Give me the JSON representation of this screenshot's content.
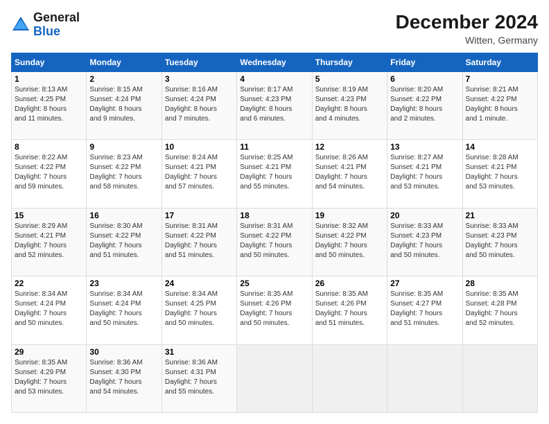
{
  "header": {
    "logo_general": "General",
    "logo_blue": "Blue",
    "month_year": "December 2024",
    "location": "Witten, Germany"
  },
  "calendar": {
    "days_of_week": [
      "Sunday",
      "Monday",
      "Tuesday",
      "Wednesday",
      "Thursday",
      "Friday",
      "Saturday"
    ],
    "weeks": [
      [
        {
          "day": "1",
          "info": "Sunrise: 8:13 AM\nSunset: 4:25 PM\nDaylight: 8 hours\nand 11 minutes."
        },
        {
          "day": "2",
          "info": "Sunrise: 8:15 AM\nSunset: 4:24 PM\nDaylight: 8 hours\nand 9 minutes."
        },
        {
          "day": "3",
          "info": "Sunrise: 8:16 AM\nSunset: 4:24 PM\nDaylight: 8 hours\nand 7 minutes."
        },
        {
          "day": "4",
          "info": "Sunrise: 8:17 AM\nSunset: 4:23 PM\nDaylight: 8 hours\nand 6 minutes."
        },
        {
          "day": "5",
          "info": "Sunrise: 8:19 AM\nSunset: 4:23 PM\nDaylight: 8 hours\nand 4 minutes."
        },
        {
          "day": "6",
          "info": "Sunrise: 8:20 AM\nSunset: 4:22 PM\nDaylight: 8 hours\nand 2 minutes."
        },
        {
          "day": "7",
          "info": "Sunrise: 8:21 AM\nSunset: 4:22 PM\nDaylight: 8 hours\nand 1 minute."
        }
      ],
      [
        {
          "day": "8",
          "info": "Sunrise: 8:22 AM\nSunset: 4:22 PM\nDaylight: 7 hours\nand 59 minutes."
        },
        {
          "day": "9",
          "info": "Sunrise: 8:23 AM\nSunset: 4:22 PM\nDaylight: 7 hours\nand 58 minutes."
        },
        {
          "day": "10",
          "info": "Sunrise: 8:24 AM\nSunset: 4:21 PM\nDaylight: 7 hours\nand 57 minutes."
        },
        {
          "day": "11",
          "info": "Sunrise: 8:25 AM\nSunset: 4:21 PM\nDaylight: 7 hours\nand 55 minutes."
        },
        {
          "day": "12",
          "info": "Sunrise: 8:26 AM\nSunset: 4:21 PM\nDaylight: 7 hours\nand 54 minutes."
        },
        {
          "day": "13",
          "info": "Sunrise: 8:27 AM\nSunset: 4:21 PM\nDaylight: 7 hours\nand 53 minutes."
        },
        {
          "day": "14",
          "info": "Sunrise: 8:28 AM\nSunset: 4:21 PM\nDaylight: 7 hours\nand 53 minutes."
        }
      ],
      [
        {
          "day": "15",
          "info": "Sunrise: 8:29 AM\nSunset: 4:21 PM\nDaylight: 7 hours\nand 52 minutes."
        },
        {
          "day": "16",
          "info": "Sunrise: 8:30 AM\nSunset: 4:22 PM\nDaylight: 7 hours\nand 51 minutes."
        },
        {
          "day": "17",
          "info": "Sunrise: 8:31 AM\nSunset: 4:22 PM\nDaylight: 7 hours\nand 51 minutes."
        },
        {
          "day": "18",
          "info": "Sunrise: 8:31 AM\nSunset: 4:22 PM\nDaylight: 7 hours\nand 50 minutes."
        },
        {
          "day": "19",
          "info": "Sunrise: 8:32 AM\nSunset: 4:22 PM\nDaylight: 7 hours\nand 50 minutes."
        },
        {
          "day": "20",
          "info": "Sunrise: 8:33 AM\nSunset: 4:23 PM\nDaylight: 7 hours\nand 50 minutes."
        },
        {
          "day": "21",
          "info": "Sunrise: 8:33 AM\nSunset: 4:23 PM\nDaylight: 7 hours\nand 50 minutes."
        }
      ],
      [
        {
          "day": "22",
          "info": "Sunrise: 8:34 AM\nSunset: 4:24 PM\nDaylight: 7 hours\nand 50 minutes."
        },
        {
          "day": "23",
          "info": "Sunrise: 8:34 AM\nSunset: 4:24 PM\nDaylight: 7 hours\nand 50 minutes."
        },
        {
          "day": "24",
          "info": "Sunrise: 8:34 AM\nSunset: 4:25 PM\nDaylight: 7 hours\nand 50 minutes."
        },
        {
          "day": "25",
          "info": "Sunrise: 8:35 AM\nSunset: 4:26 PM\nDaylight: 7 hours\nand 50 minutes."
        },
        {
          "day": "26",
          "info": "Sunrise: 8:35 AM\nSunset: 4:26 PM\nDaylight: 7 hours\nand 51 minutes."
        },
        {
          "day": "27",
          "info": "Sunrise: 8:35 AM\nSunset: 4:27 PM\nDaylight: 7 hours\nand 51 minutes."
        },
        {
          "day": "28",
          "info": "Sunrise: 8:35 AM\nSunset: 4:28 PM\nDaylight: 7 hours\nand 52 minutes."
        }
      ],
      [
        {
          "day": "29",
          "info": "Sunrise: 8:35 AM\nSunset: 4:29 PM\nDaylight: 7 hours\nand 53 minutes."
        },
        {
          "day": "30",
          "info": "Sunrise: 8:36 AM\nSunset: 4:30 PM\nDaylight: 7 hours\nand 54 minutes."
        },
        {
          "day": "31",
          "info": "Sunrise: 8:36 AM\nSunset: 4:31 PM\nDaylight: 7 hours\nand 55 minutes."
        },
        null,
        null,
        null,
        null
      ]
    ]
  }
}
